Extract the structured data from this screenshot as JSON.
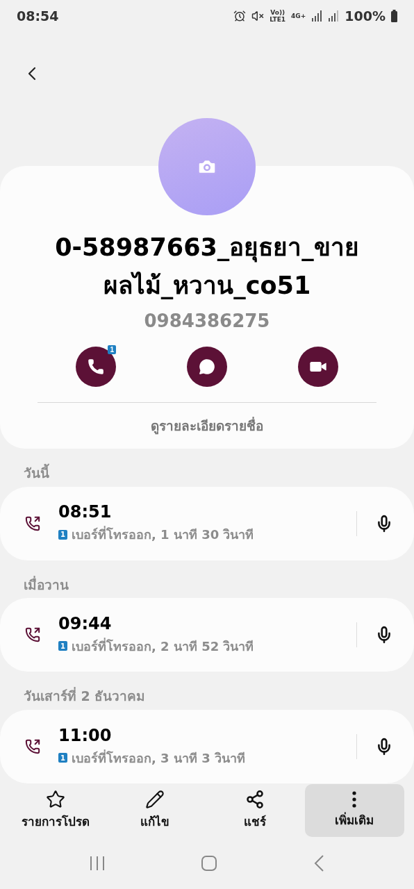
{
  "status_bar": {
    "time": "08:54",
    "network_top": "Vo))",
    "network_bottom": "LTE1",
    "data_type": "4G+",
    "battery": "100%"
  },
  "contact": {
    "name": "0-58987663_อยุธยา_ขายผลไม้_หวาน_co51",
    "phone": "0984386275",
    "call_badge": "1",
    "details_link": "ดูรายละเอียดรายชื่อ"
  },
  "history": [
    {
      "heading": "วันนี้",
      "time": "08:51",
      "sim": "1",
      "detail": "เบอร์ที่โทรออก, 1 นาที 30 วินาที"
    },
    {
      "heading": "เมื่อวาน",
      "time": "09:44",
      "sim": "1",
      "detail": "เบอร์ที่โทรออก, 2 นาที 52 วินาที"
    },
    {
      "heading": "วันเสาร์ที่ 2 ธันวาคม",
      "time": "11:00",
      "sim": "1",
      "detail": "เบอร์ที่โทรออก, 3 นาที 3 วินาที"
    }
  ],
  "toolbar": [
    {
      "kind": "star",
      "label": "รายการโปรด",
      "selected": false
    },
    {
      "kind": "edit",
      "label": "แก้ไข",
      "selected": false
    },
    {
      "kind": "share",
      "label": "แชร์",
      "selected": false
    },
    {
      "kind": "more",
      "label": "เพิ่มเติม",
      "selected": true
    }
  ]
}
